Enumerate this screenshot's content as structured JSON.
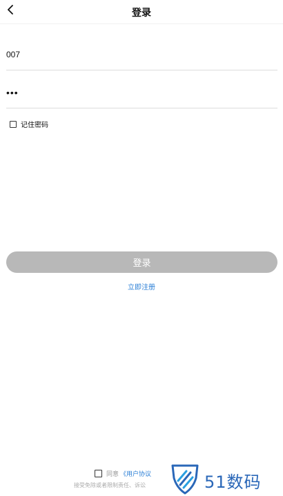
{
  "header": {
    "title": "登录",
    "back_icon": "chevron-left-icon"
  },
  "form": {
    "username_value": "007",
    "password_value": "•••",
    "remember_label": "记住密码",
    "remember_checked": false
  },
  "actions": {
    "login_label": "登录",
    "login_color": "#b8b8b8",
    "register_label": "立即注册",
    "link_color": "#2b7fd6"
  },
  "footer": {
    "agree_prefix": "同意",
    "agreement_link": "《用户协议",
    "disclaimer": "接受免除或者限制责任、诉讼",
    "agree_checked": false
  },
  "watermark": {
    "text": "51数码",
    "icon": "shield-logo-icon"
  }
}
